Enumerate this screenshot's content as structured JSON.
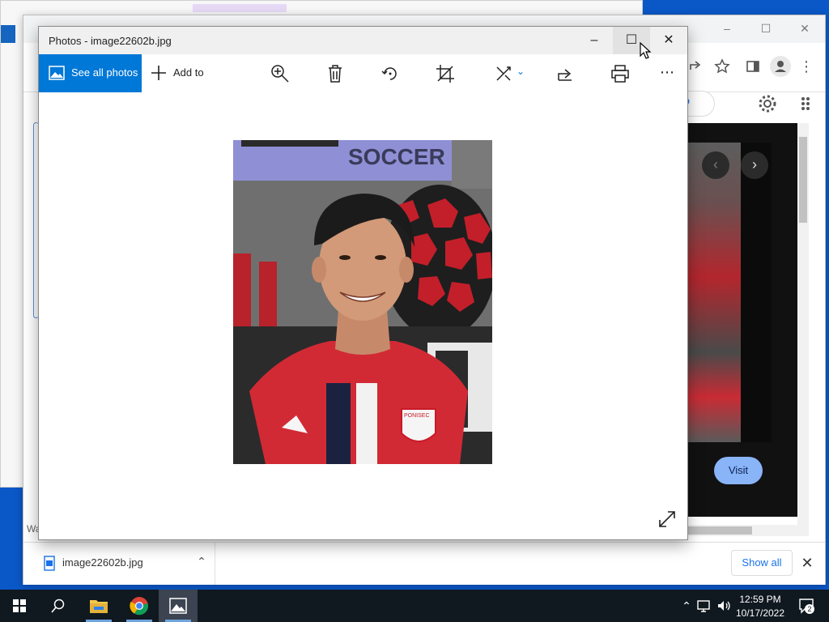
{
  "photos_window": {
    "title": "Photos - image22602b.jpg",
    "toolbar": {
      "see_all_photos": "See all photos",
      "add_to": "Add to"
    },
    "image": {
      "banner_text": "SOCCER",
      "jersey_badge_text": "PONISEC"
    }
  },
  "chrome_window": {
    "visit_label": "Visit",
    "partial_text_left": "Wa",
    "download_bar": {
      "file_name": "image22602b.jpg",
      "show_all": "Show all"
    }
  },
  "taskbar": {
    "time": "12:59 PM",
    "date": "10/17/2022",
    "notification_count": "2"
  },
  "colors": {
    "accent": "#0078d7",
    "desktop": "#0a58c8",
    "taskbar": "#101820",
    "visit_button": "#8ab4f8"
  }
}
